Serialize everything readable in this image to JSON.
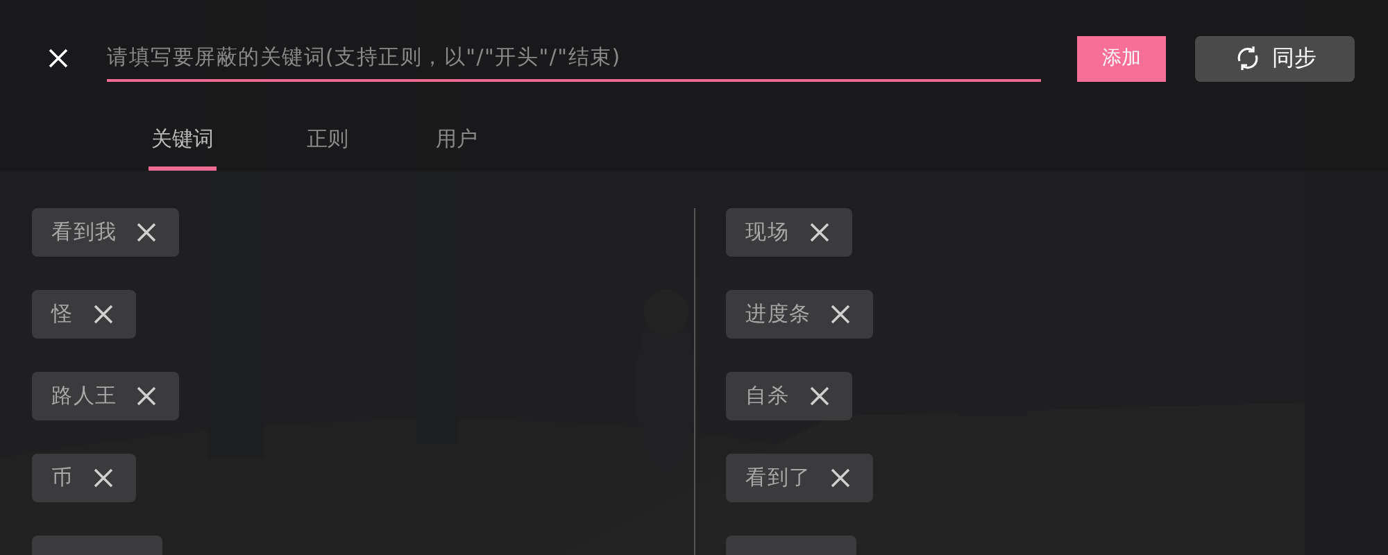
{
  "search": {
    "placeholder": "请填写要屏蔽的关键词(支持正则，以\"/\"开头\"/\"结束)"
  },
  "buttons": [
    {
      "kind": "add",
      "label": "添加"
    },
    {
      "kind": "sync",
      "label": "同步"
    }
  ],
  "tabs": [
    {
      "label": "关键词",
      "selected": true
    },
    {
      "label": "正则",
      "selected": false
    },
    {
      "label": "用户",
      "selected": false
    }
  ],
  "keyword_columns": [
    [
      {
        "kind": "word",
        "text": "看到我"
      },
      {
        "kind": "word",
        "text": "怪"
      },
      {
        "kind": "word",
        "text": "路人王"
      },
      {
        "kind": "word",
        "text": "币"
      },
      {
        "kind": "cut"
      }
    ],
    [
      {
        "kind": "word",
        "text": "现场"
      },
      {
        "kind": "word",
        "text": "进度条"
      },
      {
        "kind": "word",
        "text": "自杀"
      },
      {
        "kind": "word",
        "text": "看到了"
      },
      {
        "kind": "cut"
      }
    ]
  ]
}
